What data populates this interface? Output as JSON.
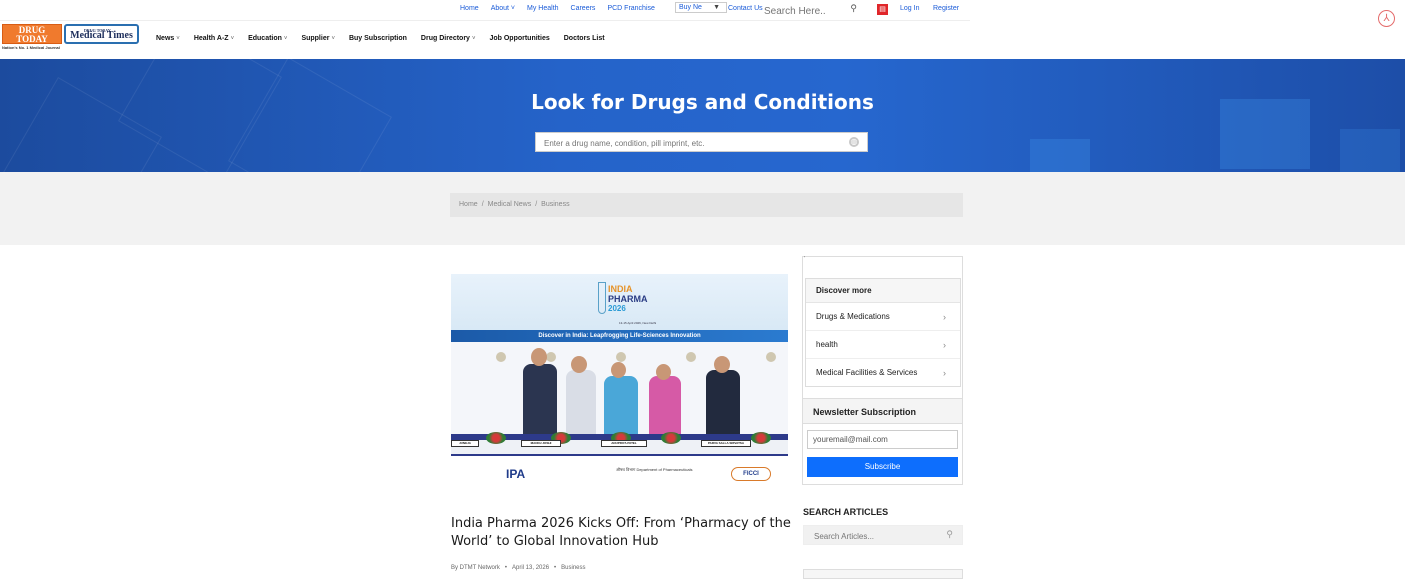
{
  "topbar": {
    "links": [
      "Home",
      "About ˅",
      "My Health",
      "Careers",
      "PCD Franchise"
    ],
    "selector_label": "Buy Ne",
    "contact": "Contact Us",
    "search_placeholder": "Search Here..",
    "pdf_badge": "PDF",
    "login": "Log In",
    "register": "Register"
  },
  "logo": {
    "drug_today": "DRUG TODAY",
    "medical_times": "Medical Times",
    "small": "DRUG TODAY",
    "tagline": "Nation's No. 1 Medical Journal"
  },
  "nav": [
    {
      "label": "News",
      "caret": "˅"
    },
    {
      "label": "Health A-Z",
      "caret": "˅"
    },
    {
      "label": "Education",
      "caret": "˅"
    },
    {
      "label": "Supplier",
      "caret": "˅"
    },
    {
      "label": "Buy Subscription",
      "caret": ""
    },
    {
      "label": "Drug Directory",
      "caret": "˅"
    },
    {
      "label": "Job Opportunities",
      "caret": ""
    },
    {
      "label": "Doctors List",
      "caret": ""
    }
  ],
  "hero": {
    "title": "Look for Drugs and Conditions",
    "search_placeholder": "Enter a drug name, condition, pill imprint, etc."
  },
  "breadcrumb": [
    "Home",
    "Medical News",
    "Business"
  ],
  "article": {
    "image_text": {
      "india": "INDIA",
      "pharma": "PHARMA",
      "year": "2026",
      "dates": "13-15 April 2026, New Delhi",
      "strip": "Discover in India: Leapfrogging Life-Sciences Innovation",
      "nameplates": [
        "JUNEJA",
        "MANOJ JOSHI",
        "ANUPRIYA PATEL",
        "PARVA SALLA SRIVATSA"
      ],
      "ipa": "IPA",
      "dept": "औषध विभाग Department of Pharmaceuticals",
      "ficci": "FICCI"
    },
    "title": "India Pharma 2026 Kicks Off: From ‘Pharmacy of the World’ to Global Innovation Hub",
    "author": "By DTMT Network",
    "date": "April 13, 2026",
    "category": "Business"
  },
  "sidebar": {
    "discover_title": "Discover more",
    "discover_items": [
      "Drugs & Medications",
      "health",
      "Medical Facilities & Services"
    ],
    "newsletter_title": "Newsletter Subscription",
    "newsletter_value": "youremail@mail.com",
    "subscribe_label": "Subscribe",
    "search_title": "SEARCH ARTICLES",
    "search_placeholder": "Search Articles..."
  },
  "colors": {
    "hero_blue": "#2563c9",
    "link_blue": "#1a5bd8",
    "button_blue": "#0d6efd",
    "band_gray": "#f2f2f2"
  },
  "icons": [
    "search-icon",
    "pdf-icon",
    "acrobat-icon",
    "globe-icon",
    "chevron-right-icon"
  ]
}
